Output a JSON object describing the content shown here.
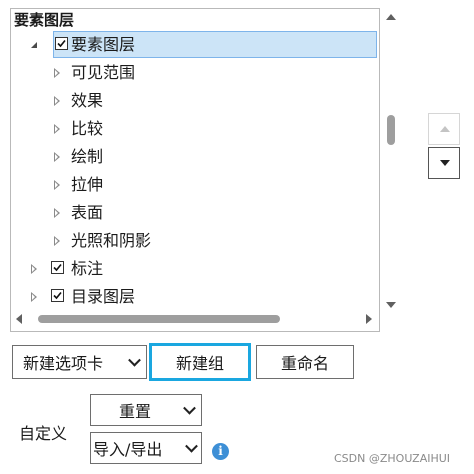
{
  "tree": {
    "header": "要素图层",
    "items": [
      {
        "label": "要素图层",
        "checked": true,
        "expanded": true,
        "selected": true
      },
      {
        "label": "可见范围"
      },
      {
        "label": "效果"
      },
      {
        "label": "比较"
      },
      {
        "label": "绘制"
      },
      {
        "label": "拉伸"
      },
      {
        "label": "表面"
      },
      {
        "label": "光照和阴影"
      },
      {
        "label": "标注",
        "checked": true
      },
      {
        "label": "目录图层",
        "checked": true
      }
    ]
  },
  "controls": {
    "new_tab_dropdown": "新建选项卡",
    "new_group_button": "新建组",
    "rename_button": "重命名",
    "custom_label": "自定义",
    "reset_dropdown": "重置",
    "import_export_dropdown": "导入/导出"
  },
  "icons": {
    "info": "i",
    "move_up": "triangle-up",
    "move_down": "triangle-down"
  },
  "watermark": "CSDN @ZHOUZAIHUI",
  "colors": {
    "selection": "#cce4f7",
    "focus": "#1aa7e0",
    "info": "#3d8fd6"
  }
}
